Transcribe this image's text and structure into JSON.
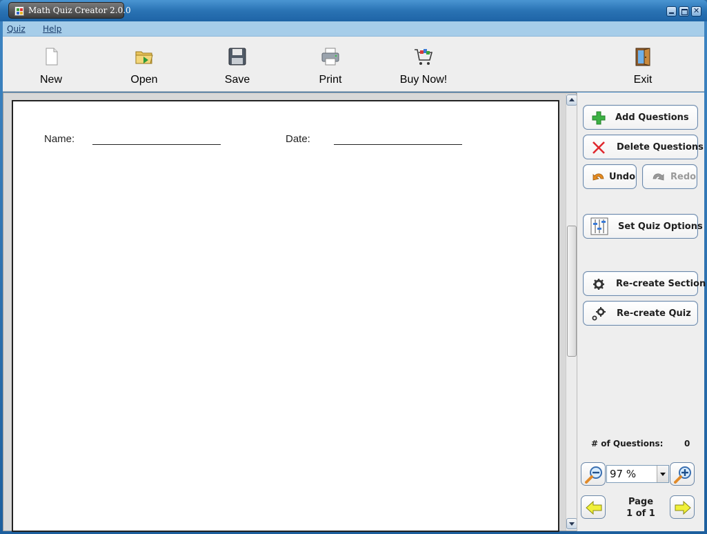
{
  "window": {
    "title": "Math Quiz Creator 2.0.0"
  },
  "menu": {
    "quiz": "Quiz",
    "help": "Help"
  },
  "toolbar": {
    "new": "New",
    "open": "Open",
    "save": "Save",
    "print": "Print",
    "buy": "Buy Now!",
    "exit": "Exit"
  },
  "document": {
    "name_label": "Name:",
    "date_label": "Date:"
  },
  "sidebar": {
    "add_questions": "Add Questions",
    "delete_questions": "Delete Questions",
    "undo": "Undo",
    "redo": "Redo",
    "set_quiz_options": "Set Quiz Options",
    "recreate_section": "Re-create Section",
    "recreate_quiz": "Re-create Quiz",
    "question_count_label": "# of Questions:",
    "question_count": "0",
    "zoom": "97 %",
    "page_label": "Page",
    "page_status": "1 of 1"
  },
  "colors": {
    "title_bar": "#2a73b4",
    "menu_bar": "#a6cde9",
    "toolbar_bg": "#eeeeee",
    "button_border": "#6b87a8"
  },
  "icons": {
    "new": "new-document-icon",
    "open": "open-folder-icon",
    "save": "floppy-disk-icon",
    "print": "printer-icon",
    "buy": "shopping-cart-icon",
    "exit": "exit-door-icon"
  }
}
